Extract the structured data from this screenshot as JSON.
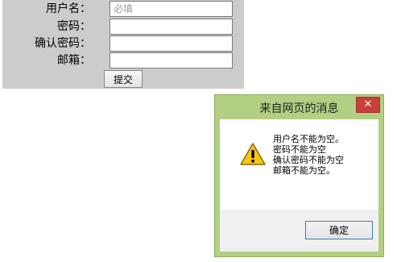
{
  "form": {
    "username_label": "用户名：",
    "username_placeholder": "必填",
    "password_label": "密码：",
    "confirm_password_label": "确认密码：",
    "email_label": "邮箱：",
    "submit_label": "提交"
  },
  "dialog": {
    "title": "来自网页的消息",
    "close_symbol": "✕",
    "messages": [
      "用户名不能为空。",
      "密码不能为空",
      "确认密码不能为空",
      "邮箱不能为空。"
    ],
    "ok_label": "确定",
    "icon": "warning-icon"
  },
  "colors": {
    "form_background": "#cccccc",
    "dialog_frame": "#b3cf82",
    "close_button": "#c7403a",
    "warning_yellow": "#f5c518"
  }
}
